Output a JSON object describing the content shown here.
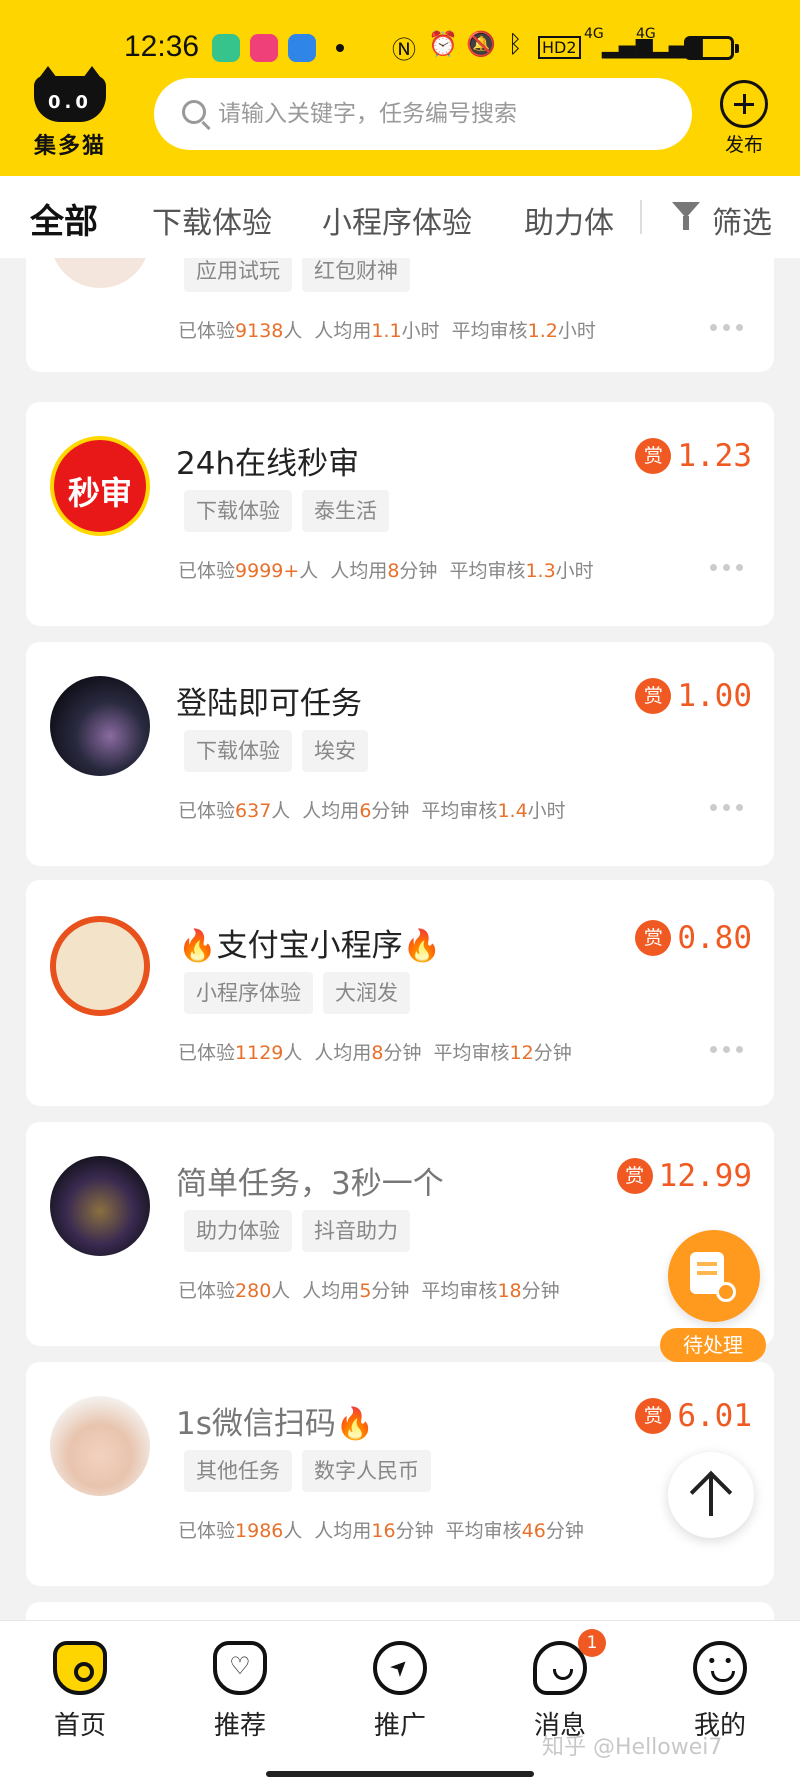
{
  "status_bar": {
    "time": "12:36",
    "signal_label_1": "4G",
    "signal_label_2": "4G",
    "hd_label": "HD2",
    "battery_level": 0.28
  },
  "header": {
    "logo_eyes": "0.0",
    "logo_text": "集多猫",
    "search_placeholder": "请输入关键字，任务编号搜索",
    "publish_label": "发布"
  },
  "tabs": [
    "全部",
    "下载体验",
    "小程序体验",
    "助力体"
  ],
  "filter_label": "筛选",
  "tasks": [
    {
      "title": "",
      "reward": "",
      "tags": [
        "应用试玩",
        "红包财神"
      ],
      "participants": "9138",
      "avg_time": "1.1",
      "avg_time_unit": "小时",
      "avg_review": "1.2",
      "avg_review_unit": "小时"
    },
    {
      "title": "24h在线秒审",
      "reward": "1.23",
      "avatar_text": "秒审",
      "tags": [
        "下载体验",
        "泰生活"
      ],
      "participants": "9999+",
      "avg_time": "8",
      "avg_time_unit": "分钟",
      "avg_review": "1.3",
      "avg_review_unit": "小时"
    },
    {
      "title": "登陆即可任务",
      "reward": "1.00",
      "tags": [
        "下载体验",
        "埃安"
      ],
      "participants": "637",
      "avg_time": "6",
      "avg_time_unit": "分钟",
      "avg_review": "1.4",
      "avg_review_unit": "小时"
    },
    {
      "title": "🔥支付宝小程序🔥",
      "reward": "0.80",
      "tags": [
        "小程序体验",
        "大润发"
      ],
      "participants": "1129",
      "avg_time": "8",
      "avg_time_unit": "分钟",
      "avg_review": "12",
      "avg_review_unit": "分钟"
    },
    {
      "title": "简单任务，3秒一个",
      "reward": "12.99",
      "tags": [
        "助力体验",
        "抖音助力"
      ],
      "participants": "280",
      "avg_time": "5",
      "avg_time_unit": "分钟",
      "avg_review": "18",
      "avg_review_unit": "分钟"
    },
    {
      "title": "1s微信扫码🔥",
      "reward": "6.01",
      "tags": [
        "其他任务",
        "数字人民币"
      ],
      "participants": "1986",
      "avg_time": "16",
      "avg_time_unit": "分钟",
      "avg_review": "46",
      "avg_review_unit": "分钟"
    }
  ],
  "labels": {
    "participants_prefix": "已体验",
    "participants_suffix": "人",
    "avg_time_prefix": "人均用",
    "avg_review_prefix": "平均审核",
    "reward_badge": "赏"
  },
  "pending_label": "待处理",
  "bottom_nav": [
    {
      "label": "首页",
      "icon": "home-cat-icon"
    },
    {
      "label": "推荐",
      "icon": "recommend-heart-icon"
    },
    {
      "label": "推广",
      "icon": "promote-send-icon"
    },
    {
      "label": "消息",
      "icon": "message-icon",
      "badge": "1"
    },
    {
      "label": "我的",
      "icon": "profile-face-icon"
    }
  ],
  "watermark": "知乎 @Hellowei7"
}
